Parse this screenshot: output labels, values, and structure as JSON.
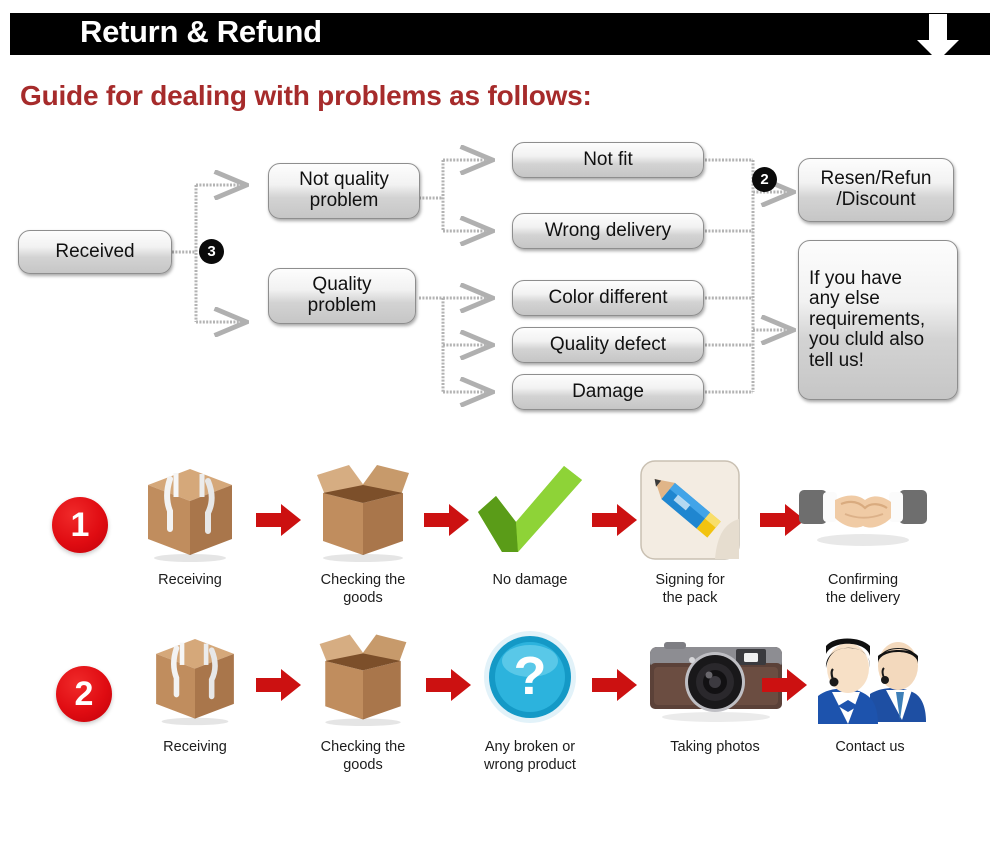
{
  "header": {
    "title": "Return & Refund",
    "arrow_icon": "down-arrow-icon"
  },
  "page_heading": "Guide for dealing with problems as follows:",
  "colors": {
    "header_bar": "#000000",
    "heading_red": "#a62b2b",
    "badge_black": "#0a0a0a",
    "badge_red": "#e00c12",
    "arrow_red": "#cc1111",
    "node_border": "#8e8e8e",
    "connector_gray": "#a9a9a9"
  },
  "flowchart": {
    "start_node": "Received",
    "branch_badge": "3",
    "decision_badge": "2",
    "categories": [
      {
        "label": "Not quality\nproblem",
        "line1": "Not quality",
        "line2": "problem"
      },
      {
        "label": "Quality\nproblem",
        "line1": "Quality",
        "line2": "problem"
      }
    ],
    "issues": [
      "Not fit",
      "Wrong delivery",
      "Color different",
      "Quality defect",
      "Damage"
    ],
    "outcomes": [
      {
        "line1": "Resen/Refun",
        "line2": "/Discount"
      },
      {
        "text": "If you have any else requirements, you cluld also tell us!",
        "lines": [
          "If you have",
          "any else",
          "requirements,",
          "you cluld also",
          "tell us!"
        ]
      }
    ]
  },
  "process": {
    "rows": [
      {
        "badge": "1",
        "steps": [
          {
            "icon": "sealed-box-icon",
            "label": "Receiving",
            "lines": [
              "Receiving"
            ]
          },
          {
            "icon": "open-box-icon",
            "label": "Checking the goods",
            "lines": [
              "Checking the",
              "goods"
            ]
          },
          {
            "icon": "green-check-icon",
            "label": "No damage",
            "lines": [
              "No damage"
            ]
          },
          {
            "icon": "pencil-signing-icon",
            "label": "Signing for the pack",
            "lines": [
              "Signing for",
              "the pack"
            ]
          },
          {
            "icon": "handshake-icon",
            "label": "Confirming the delivery",
            "lines": [
              "Confirming",
              "the delivery"
            ]
          }
        ]
      },
      {
        "badge": "2",
        "steps": [
          {
            "icon": "sealed-box-icon",
            "label": "Receiving",
            "lines": [
              "Receiving"
            ]
          },
          {
            "icon": "open-box-icon",
            "label": "Checking the goods",
            "lines": [
              "Checking the",
              "goods"
            ]
          },
          {
            "icon": "question-mark-icon",
            "label": "Any broken or wrong product",
            "lines": [
              "Any broken or",
              "wrong product"
            ]
          },
          {
            "icon": "camera-icon",
            "label": "Taking photos",
            "lines": [
              "Taking photos"
            ]
          },
          {
            "icon": "support-people-icon",
            "label": "Contact us",
            "lines": [
              "Contact us"
            ]
          }
        ]
      }
    ]
  }
}
